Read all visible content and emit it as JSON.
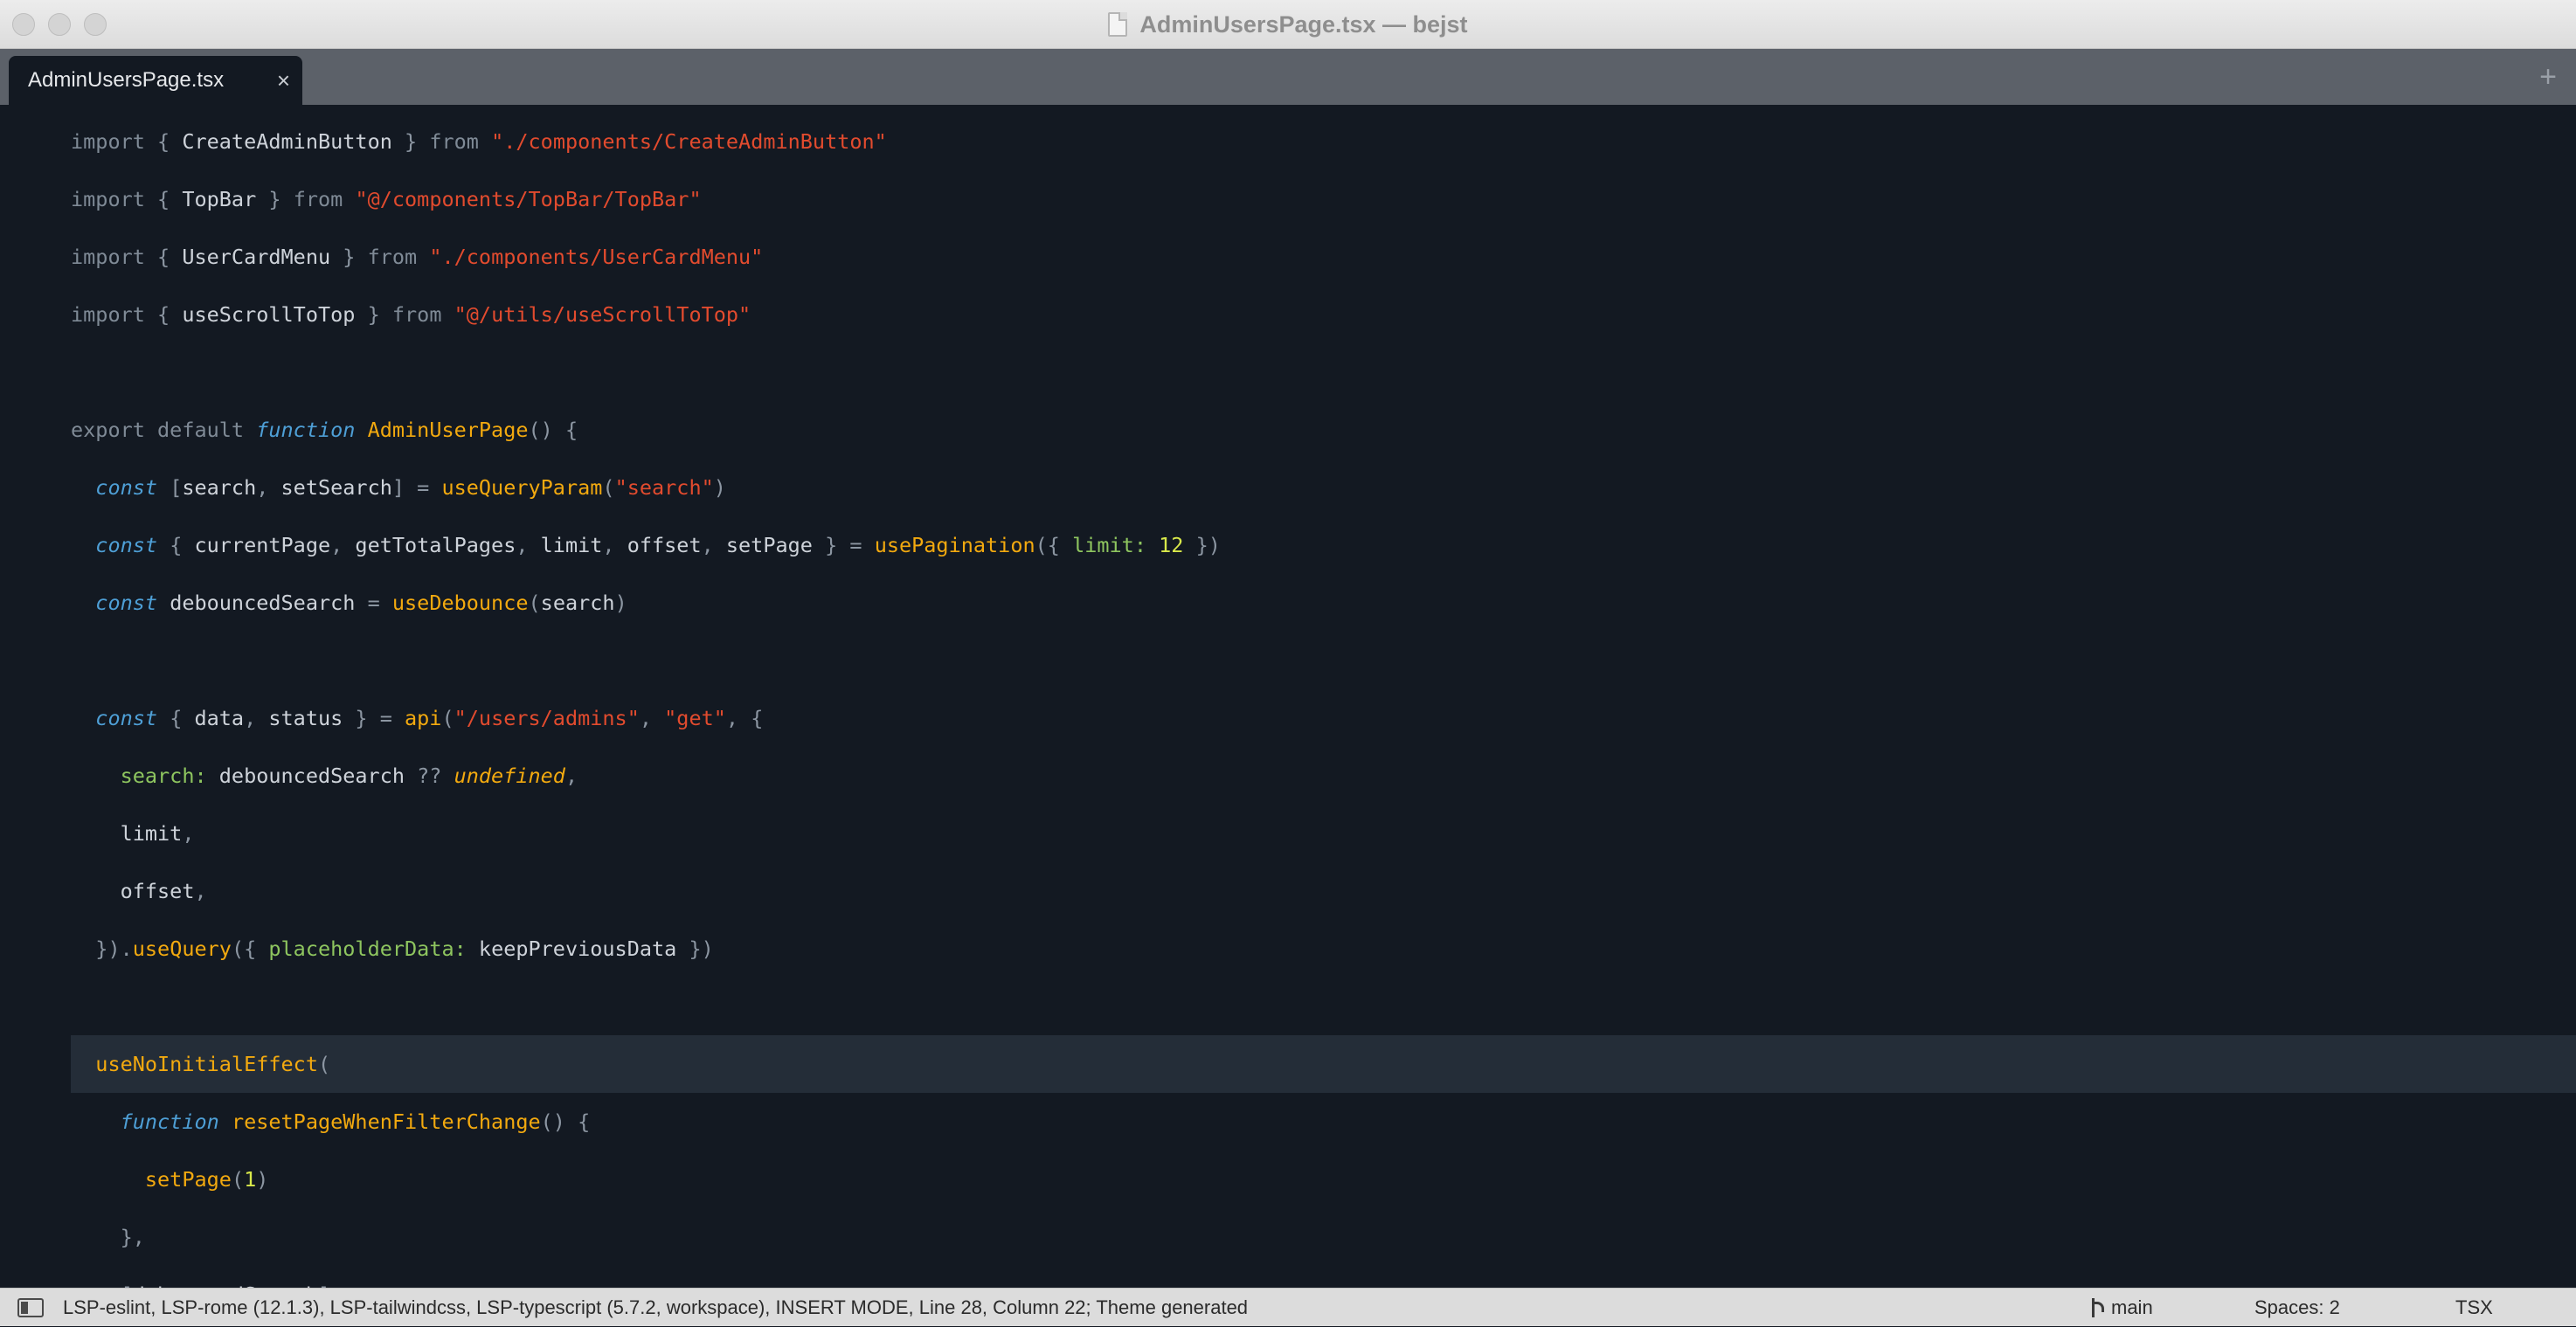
{
  "window": {
    "title": "AdminUsersPage.tsx — bejst"
  },
  "tabs": {
    "active_label": "AdminUsersPage.tsx",
    "close_glyph": "×",
    "new_tab_glyph": "+"
  },
  "editor": {
    "highlighted_line_index": 16,
    "lines": [
      [
        [
          "kw",
          "import "
        ],
        [
          "p",
          "{ "
        ],
        [
          "id",
          "CreateAdminButton"
        ],
        [
          "p",
          " } "
        ],
        [
          "kw",
          "from "
        ],
        [
          "str",
          "\"./components/CreateAdminButton\""
        ]
      ],
      [
        [
          "kw",
          "import "
        ],
        [
          "p",
          "{ "
        ],
        [
          "id",
          "TopBar"
        ],
        [
          "p",
          " } "
        ],
        [
          "kw",
          "from "
        ],
        [
          "str",
          "\"@/components/TopBar/TopBar\""
        ]
      ],
      [
        [
          "kw",
          "import "
        ],
        [
          "p",
          "{ "
        ],
        [
          "id",
          "UserCardMenu"
        ],
        [
          "p",
          " } "
        ],
        [
          "kw",
          "from "
        ],
        [
          "str",
          "\"./components/UserCardMenu\""
        ]
      ],
      [
        [
          "kw",
          "import "
        ],
        [
          "p",
          "{ "
        ],
        [
          "id",
          "useScrollToTop"
        ],
        [
          "p",
          " } "
        ],
        [
          "kw",
          "from "
        ],
        [
          "str",
          "\"@/utils/useScrollToTop\""
        ]
      ],
      [],
      [
        [
          "kw",
          "export default "
        ],
        [
          "kwi",
          "function "
        ],
        [
          "fn",
          "AdminUserPage"
        ],
        [
          "p",
          "() {"
        ]
      ],
      [
        [
          "kwi",
          "  const "
        ],
        [
          "p",
          "["
        ],
        [
          "id",
          "search"
        ],
        [
          "p",
          ", "
        ],
        [
          "id",
          "setSearch"
        ],
        [
          "p",
          "] = "
        ],
        [
          "fn",
          "useQueryParam"
        ],
        [
          "p",
          "("
        ],
        [
          "str",
          "\"search\""
        ],
        [
          "p",
          ")"
        ]
      ],
      [
        [
          "kwi",
          "  const "
        ],
        [
          "p",
          "{ "
        ],
        [
          "id",
          "currentPage"
        ],
        [
          "p",
          ", "
        ],
        [
          "id",
          "getTotalPages"
        ],
        [
          "p",
          ", "
        ],
        [
          "id",
          "limit"
        ],
        [
          "p",
          ", "
        ],
        [
          "id",
          "offset"
        ],
        [
          "p",
          ", "
        ],
        [
          "id",
          "setPage"
        ],
        [
          "p",
          " } = "
        ],
        [
          "fn",
          "usePagination"
        ],
        [
          "p",
          "({ "
        ],
        [
          "prop",
          "limit: "
        ],
        [
          "num",
          "12"
        ],
        [
          "p",
          " })"
        ]
      ],
      [
        [
          "kwi",
          "  const "
        ],
        [
          "id",
          "debouncedSearch"
        ],
        [
          "p",
          " = "
        ],
        [
          "fn",
          "useDebounce"
        ],
        [
          "p",
          "("
        ],
        [
          "id",
          "search"
        ],
        [
          "p",
          ")"
        ]
      ],
      [],
      [
        [
          "kwi",
          "  const "
        ],
        [
          "p",
          "{ "
        ],
        [
          "id",
          "data"
        ],
        [
          "p",
          ", "
        ],
        [
          "id",
          "status"
        ],
        [
          "p",
          " } = "
        ],
        [
          "fn",
          "api"
        ],
        [
          "p",
          "("
        ],
        [
          "str",
          "\"/users/admins\""
        ],
        [
          "p",
          ", "
        ],
        [
          "str",
          "\"get\""
        ],
        [
          "p",
          ", {"
        ]
      ],
      [
        [
          "prop",
          "    search: "
        ],
        [
          "id",
          "debouncedSearch"
        ],
        [
          "p",
          " ?? "
        ],
        [
          "undef",
          "undefined"
        ],
        [
          "p",
          ","
        ]
      ],
      [
        [
          "id",
          "    limit"
        ],
        [
          "p",
          ","
        ]
      ],
      [
        [
          "id",
          "    offset"
        ],
        [
          "p",
          ","
        ]
      ],
      [
        [
          "p",
          "  })."
        ],
        [
          "fn",
          "useQuery"
        ],
        [
          "p",
          "({ "
        ],
        [
          "prop",
          "placeholderData: "
        ],
        [
          "id",
          "keepPreviousData"
        ],
        [
          "p",
          " })"
        ]
      ],
      [],
      [
        [
          "fn",
          "  useNoInitialEffect"
        ],
        [
          "p",
          "("
        ]
      ],
      [
        [
          "kwi",
          "    function "
        ],
        [
          "fn",
          "resetPageWhenFilterChange"
        ],
        [
          "p",
          "() {"
        ]
      ],
      [
        [
          "fn",
          "      setPage"
        ],
        [
          "p",
          "("
        ],
        [
          "num",
          "1"
        ],
        [
          "p",
          ")"
        ]
      ],
      [
        [
          "p",
          "    },"
        ]
      ],
      [
        [
          "p",
          "    ["
        ],
        [
          "id",
          "debouncedSearch"
        ],
        [
          "p",
          "],"
        ]
      ]
    ]
  },
  "statusbar": {
    "text": "LSP-eslint, LSP-rome (12.1.3), LSP-tailwindcss, LSP-typescript (5.7.2, workspace), INSERT MODE, Line 28, Column 22; Theme generated",
    "branch": "main",
    "spaces": "Spaces: 2",
    "syntax": "TSX"
  }
}
